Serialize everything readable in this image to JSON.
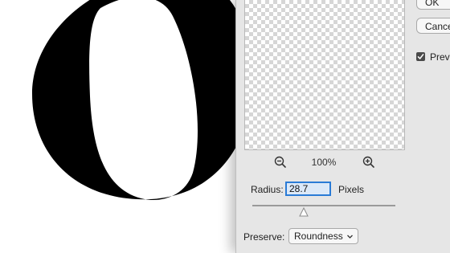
{
  "dialog": {
    "buttons": {
      "ok_label": "OK",
      "cancel_label": "Cancel"
    },
    "preview_checkbox": {
      "label": "Preview",
      "checked": true
    },
    "preview_pane": {
      "zoom_level": "100%",
      "zoom_out_icon": "zoom-out-icon",
      "zoom_in_icon": "zoom-in-icon"
    },
    "radius": {
      "label": "Radius:",
      "value": "28.7",
      "unit_label": "Pixels",
      "slider_level_fraction": 0.36
    },
    "preserve": {
      "label": "Preserve:",
      "selected": "Roundness",
      "chevron_icon": "chevron-down-icon"
    }
  },
  "canvas": {
    "glyph": "o",
    "glyph_color": "#000000",
    "background_color": "#ffffff"
  },
  "colors": {
    "accent": "#2a7bd6",
    "dialog_background": "#e6e6e6",
    "checker_light": "#ffffff",
    "checker_dark": "#d6d6d6"
  }
}
